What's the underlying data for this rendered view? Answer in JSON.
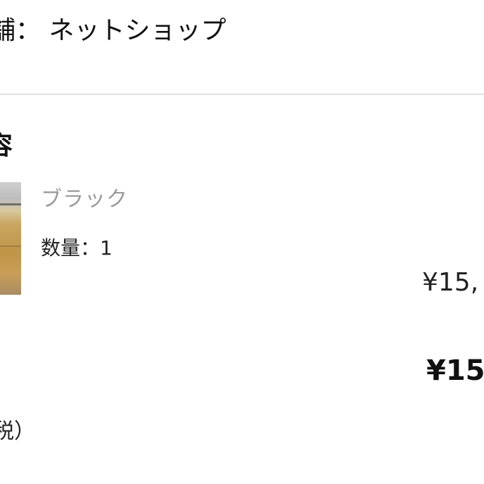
{
  "store": {
    "text": "舗： ネットショップ"
  },
  "order": {
    "section_title": "容",
    "item": {
      "variant": "ブラック",
      "quantity_text": "数量：1",
      "price": "¥15,"
    },
    "total_price": "¥15",
    "tax_note": "税）"
  }
}
